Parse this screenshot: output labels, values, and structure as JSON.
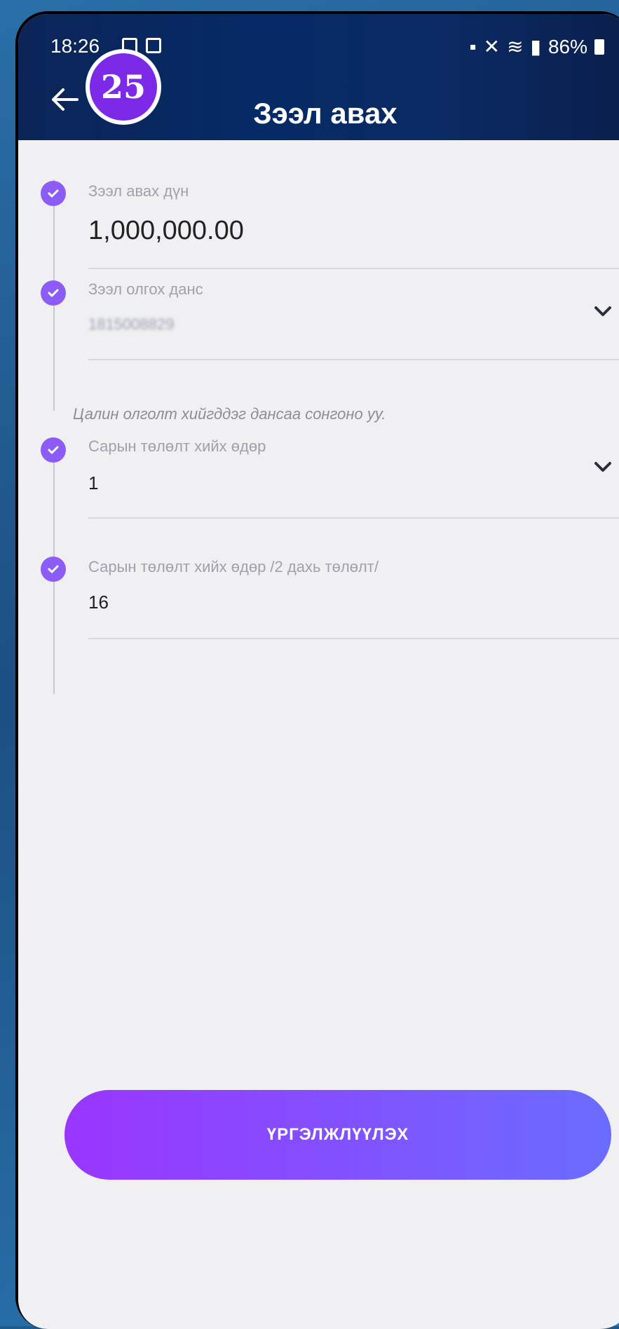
{
  "status_bar": {
    "time": "18:26",
    "battery": "86%"
  },
  "header": {
    "title": "Зээл авах",
    "badge": "25"
  },
  "form": {
    "loan_amount": {
      "label": "Зээл авах дүн",
      "value": "1,000,000.00"
    },
    "receive_account": {
      "label": "Зээл олгох данс",
      "value": "1815008829",
      "hint": "Цалин олголт хийгддэг дансаа сонгоно уу."
    },
    "payment_day": {
      "label": "Сарын төлөлт хийх өдөр",
      "value": "1"
    },
    "payment_day_2": {
      "label": "Сарын төлөлт хийх өдөр /2 дахь төлөлт/",
      "value": "16"
    }
  },
  "actions": {
    "continue_label": "ҮРГЭЛЖЛҮҮЛЭХ"
  },
  "colors": {
    "accent": "#8b5cf6",
    "header_bg": "#0b2558",
    "button_start": "#9a35ff",
    "button_end": "#6a6cff"
  }
}
